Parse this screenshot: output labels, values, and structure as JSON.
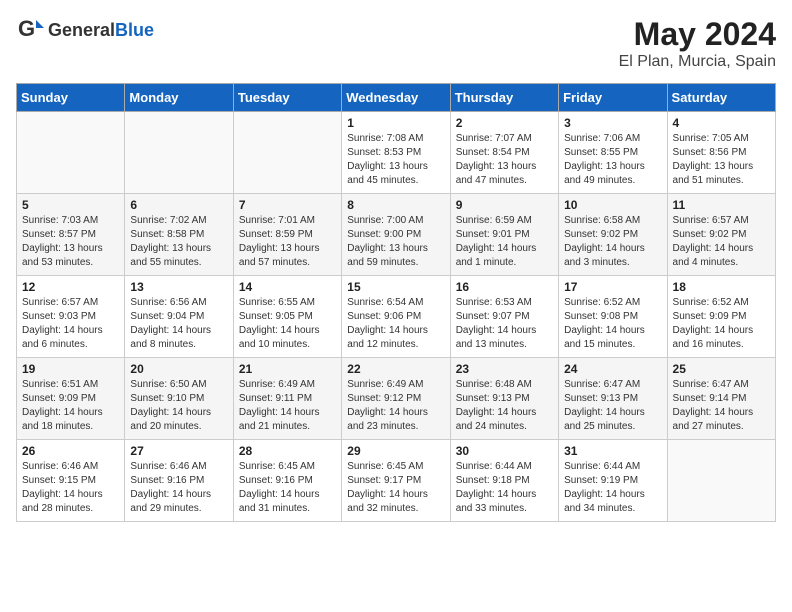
{
  "header": {
    "logo_general": "General",
    "logo_blue": "Blue",
    "title": "May 2024",
    "location": "El Plan, Murcia, Spain"
  },
  "weekdays": [
    "Sunday",
    "Monday",
    "Tuesday",
    "Wednesday",
    "Thursday",
    "Friday",
    "Saturday"
  ],
  "weeks": [
    [
      {
        "day": "",
        "info": ""
      },
      {
        "day": "",
        "info": ""
      },
      {
        "day": "",
        "info": ""
      },
      {
        "day": "1",
        "info": "Sunrise: 7:08 AM\nSunset: 8:53 PM\nDaylight: 13 hours\nand 45 minutes."
      },
      {
        "day": "2",
        "info": "Sunrise: 7:07 AM\nSunset: 8:54 PM\nDaylight: 13 hours\nand 47 minutes."
      },
      {
        "day": "3",
        "info": "Sunrise: 7:06 AM\nSunset: 8:55 PM\nDaylight: 13 hours\nand 49 minutes."
      },
      {
        "day": "4",
        "info": "Sunrise: 7:05 AM\nSunset: 8:56 PM\nDaylight: 13 hours\nand 51 minutes."
      }
    ],
    [
      {
        "day": "5",
        "info": "Sunrise: 7:03 AM\nSunset: 8:57 PM\nDaylight: 13 hours\nand 53 minutes."
      },
      {
        "day": "6",
        "info": "Sunrise: 7:02 AM\nSunset: 8:58 PM\nDaylight: 13 hours\nand 55 minutes."
      },
      {
        "day": "7",
        "info": "Sunrise: 7:01 AM\nSunset: 8:59 PM\nDaylight: 13 hours\nand 57 minutes."
      },
      {
        "day": "8",
        "info": "Sunrise: 7:00 AM\nSunset: 9:00 PM\nDaylight: 13 hours\nand 59 minutes."
      },
      {
        "day": "9",
        "info": "Sunrise: 6:59 AM\nSunset: 9:01 PM\nDaylight: 14 hours\nand 1 minute."
      },
      {
        "day": "10",
        "info": "Sunrise: 6:58 AM\nSunset: 9:02 PM\nDaylight: 14 hours\nand 3 minutes."
      },
      {
        "day": "11",
        "info": "Sunrise: 6:57 AM\nSunset: 9:02 PM\nDaylight: 14 hours\nand 4 minutes."
      }
    ],
    [
      {
        "day": "12",
        "info": "Sunrise: 6:57 AM\nSunset: 9:03 PM\nDaylight: 14 hours\nand 6 minutes."
      },
      {
        "day": "13",
        "info": "Sunrise: 6:56 AM\nSunset: 9:04 PM\nDaylight: 14 hours\nand 8 minutes."
      },
      {
        "day": "14",
        "info": "Sunrise: 6:55 AM\nSunset: 9:05 PM\nDaylight: 14 hours\nand 10 minutes."
      },
      {
        "day": "15",
        "info": "Sunrise: 6:54 AM\nSunset: 9:06 PM\nDaylight: 14 hours\nand 12 minutes."
      },
      {
        "day": "16",
        "info": "Sunrise: 6:53 AM\nSunset: 9:07 PM\nDaylight: 14 hours\nand 13 minutes."
      },
      {
        "day": "17",
        "info": "Sunrise: 6:52 AM\nSunset: 9:08 PM\nDaylight: 14 hours\nand 15 minutes."
      },
      {
        "day": "18",
        "info": "Sunrise: 6:52 AM\nSunset: 9:09 PM\nDaylight: 14 hours\nand 16 minutes."
      }
    ],
    [
      {
        "day": "19",
        "info": "Sunrise: 6:51 AM\nSunset: 9:09 PM\nDaylight: 14 hours\nand 18 minutes."
      },
      {
        "day": "20",
        "info": "Sunrise: 6:50 AM\nSunset: 9:10 PM\nDaylight: 14 hours\nand 20 minutes."
      },
      {
        "day": "21",
        "info": "Sunrise: 6:49 AM\nSunset: 9:11 PM\nDaylight: 14 hours\nand 21 minutes."
      },
      {
        "day": "22",
        "info": "Sunrise: 6:49 AM\nSunset: 9:12 PM\nDaylight: 14 hours\nand 23 minutes."
      },
      {
        "day": "23",
        "info": "Sunrise: 6:48 AM\nSunset: 9:13 PM\nDaylight: 14 hours\nand 24 minutes."
      },
      {
        "day": "24",
        "info": "Sunrise: 6:47 AM\nSunset: 9:13 PM\nDaylight: 14 hours\nand 25 minutes."
      },
      {
        "day": "25",
        "info": "Sunrise: 6:47 AM\nSunset: 9:14 PM\nDaylight: 14 hours\nand 27 minutes."
      }
    ],
    [
      {
        "day": "26",
        "info": "Sunrise: 6:46 AM\nSunset: 9:15 PM\nDaylight: 14 hours\nand 28 minutes."
      },
      {
        "day": "27",
        "info": "Sunrise: 6:46 AM\nSunset: 9:16 PM\nDaylight: 14 hours\nand 29 minutes."
      },
      {
        "day": "28",
        "info": "Sunrise: 6:45 AM\nSunset: 9:16 PM\nDaylight: 14 hours\nand 31 minutes."
      },
      {
        "day": "29",
        "info": "Sunrise: 6:45 AM\nSunset: 9:17 PM\nDaylight: 14 hours\nand 32 minutes."
      },
      {
        "day": "30",
        "info": "Sunrise: 6:44 AM\nSunset: 9:18 PM\nDaylight: 14 hours\nand 33 minutes."
      },
      {
        "day": "31",
        "info": "Sunrise: 6:44 AM\nSunset: 9:19 PM\nDaylight: 14 hours\nand 34 minutes."
      },
      {
        "day": "",
        "info": ""
      }
    ]
  ]
}
